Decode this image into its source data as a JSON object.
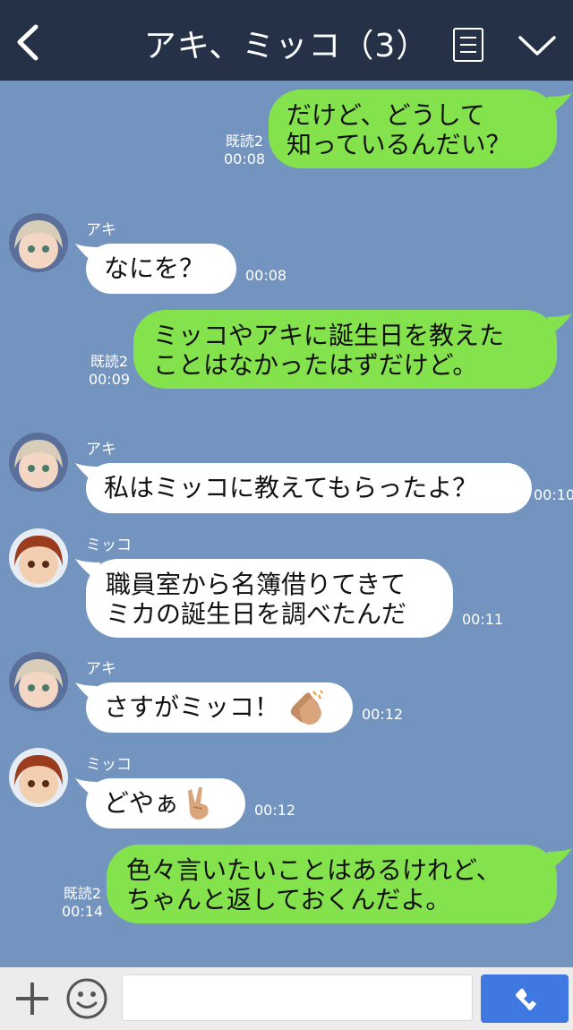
{
  "header": {
    "title": "アキ、ミッコ（3）"
  },
  "messages": [
    {
      "from": "me",
      "text": "だけど、どうして\n知っているんだい？",
      "read": "既読2",
      "time": "00:08"
    },
    {
      "from": "アキ",
      "text": "なにを？",
      "time": "00:08"
    },
    {
      "from": "me",
      "text": "ミッコやアキに誕生日を教えた\nことはなかったはずだけど。",
      "read": "既読2",
      "time": "00:09"
    },
    {
      "from": "アキ",
      "text": "私はミッコに教えてもらったよ？",
      "time": "00:10"
    },
    {
      "from": "ミッコ",
      "text": "職員室から名簿借りてきて\nミカの誕生日を調べたんだ",
      "time": "00:11"
    },
    {
      "from": "アキ",
      "text": "さすがミッコ！",
      "emoji": "clapping-hands-icon",
      "time": "00:12"
    },
    {
      "from": "ミッコ",
      "text": "どやぁ",
      "emoji": "victory-hand-icon",
      "time": "00:12"
    },
    {
      "from": "me",
      "text": "色々言いたいことはあるけれど、\nちゃんと返しておくんだよ。",
      "read": "既読2",
      "time": "00:14"
    }
  ],
  "footer": {
    "input_placeholder": ""
  },
  "colors": {
    "header_bg": "#253147",
    "chat_bg": "#7494c0",
    "outgoing_bubble": "#84e24c",
    "incoming_bubble": "#ffffff",
    "call_button": "#3f78e0"
  },
  "icons": {
    "back": "back-chevron-icon",
    "menu": "menu-list-icon",
    "collapse": "chevron-down-icon",
    "add": "plus-icon",
    "sticker": "smiley-icon",
    "call": "phone-icon"
  }
}
